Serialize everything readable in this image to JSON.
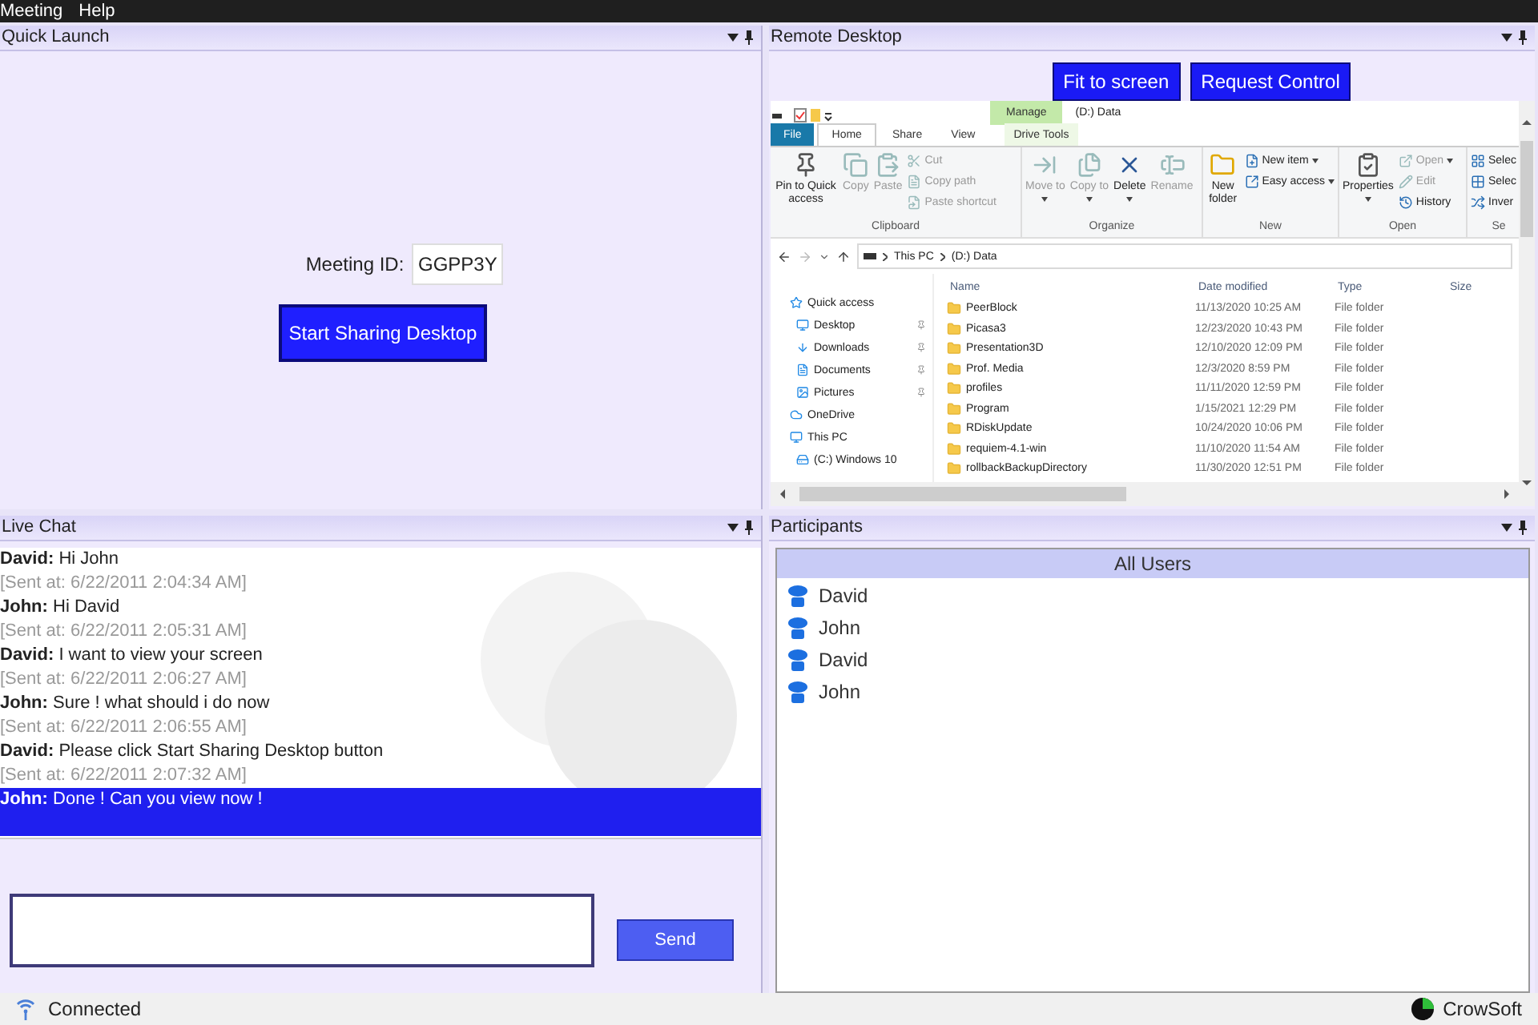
{
  "menu": [
    {
      "label": "Meeting"
    },
    {
      "label": "Help"
    }
  ],
  "quick_launch": {
    "title": "Quick Launch",
    "meeting_id_label": "Meeting ID:",
    "meeting_id": "GGPP3Y",
    "start_button": "Start Sharing Desktop"
  },
  "remote_desktop": {
    "title": "Remote Desktop",
    "buttons": [
      "Fit to screen",
      "Request Control"
    ],
    "explorer": {
      "context_tab": "Manage",
      "title": "(D:) Data",
      "tabs": [
        {
          "label": "File",
          "kind": "file",
          "selected": false
        },
        {
          "label": "Home",
          "kind": "tab",
          "selected": true
        },
        {
          "label": "Share",
          "kind": "tab",
          "selected": false
        },
        {
          "label": "View",
          "kind": "tab",
          "selected": false
        },
        {
          "label": "Drive Tools",
          "kind": "context",
          "selected": false
        }
      ],
      "groups": [
        {
          "label": "Clipboard",
          "commands": [
            {
              "label": "Pin to Quick access",
              "kind": "large",
              "disabled": false,
              "caret": false
            },
            {
              "label": "Copy",
              "kind": "large",
              "disabled": true,
              "caret": false
            },
            {
              "label": "Paste",
              "kind": "large",
              "disabled": true,
              "caret": false
            },
            {
              "label": "Cut",
              "kind": "small",
              "disabled": true,
              "caret": false
            },
            {
              "label": "Copy path",
              "kind": "small",
              "disabled": true,
              "caret": false
            },
            {
              "label": "Paste shortcut",
              "kind": "small",
              "disabled": true,
              "caret": false
            }
          ]
        },
        {
          "label": "Organize",
          "commands": [
            {
              "label": "Move to",
              "kind": "large",
              "disabled": true,
              "caret": true
            },
            {
              "label": "Copy to",
              "kind": "large",
              "disabled": true,
              "caret": true
            },
            {
              "label": "Delete",
              "kind": "large",
              "disabled": false,
              "caret": true
            },
            {
              "label": "Rename",
              "kind": "large",
              "disabled": true,
              "caret": false
            }
          ]
        },
        {
          "label": "New",
          "commands": [
            {
              "label": "New folder",
              "kind": "large",
              "disabled": false,
              "caret": false
            },
            {
              "label": "New item",
              "kind": "small",
              "disabled": false,
              "caret": true
            },
            {
              "label": "Easy access",
              "kind": "small",
              "disabled": false,
              "caret": true
            }
          ]
        },
        {
          "label": "Open",
          "commands": [
            {
              "label": "Properties",
              "kind": "large",
              "disabled": false,
              "caret": true
            },
            {
              "label": "Open",
              "kind": "small",
              "disabled": true,
              "caret": true
            },
            {
              "label": "Edit",
              "kind": "small",
              "disabled": true,
              "caret": false
            },
            {
              "label": "History",
              "kind": "small",
              "disabled": false,
              "caret": false
            }
          ]
        },
        {
          "label": "Se",
          "commands": [
            {
              "label": "Selec",
              "kind": "small",
              "disabled": false,
              "caret": false
            },
            {
              "label": "Selec",
              "kind": "small",
              "disabled": false,
              "caret": false
            },
            {
              "label": "Inver",
              "kind": "small",
              "disabled": false,
              "caret": false
            }
          ]
        }
      ],
      "path": [
        "This PC",
        "(D:) Data"
      ],
      "nav": [
        {
          "label": "Quick access",
          "kind": "star",
          "children": [
            {
              "label": "Desktop",
              "kind": "desktop",
              "pinned": true
            },
            {
              "label": "Downloads",
              "kind": "download",
              "pinned": true
            },
            {
              "label": "Documents",
              "kind": "document",
              "pinned": true
            },
            {
              "label": "Pictures",
              "kind": "picture",
              "pinned": true
            }
          ]
        },
        {
          "label": "OneDrive",
          "kind": "cloud"
        },
        {
          "label": "This PC",
          "kind": "pc",
          "children": [
            {
              "label": "(C:) Windows 10",
              "kind": "drive",
              "pinned": false
            }
          ]
        }
      ],
      "columns": [
        "Name",
        "Date modified",
        "Type",
        "Size"
      ],
      "files": [
        {
          "name": "PeerBlock",
          "modified": "11/13/2020 10:25 AM",
          "type": "File folder"
        },
        {
          "name": "Picasa3",
          "modified": "12/23/2020 10:43 PM",
          "type": "File folder"
        },
        {
          "name": "Presentation3D",
          "modified": "12/10/2020 12:09 PM",
          "type": "File folder"
        },
        {
          "name": "Prof. Media",
          "modified": "12/3/2020 8:59 PM",
          "type": "File folder"
        },
        {
          "name": "profiles",
          "modified": "11/11/2020 12:59 PM",
          "type": "File folder"
        },
        {
          "name": "Program",
          "modified": "1/15/2021 12:29 PM",
          "type": "File folder"
        },
        {
          "name": "RDiskUpdate",
          "modified": "10/24/2020 10:06 PM",
          "type": "File folder"
        },
        {
          "name": "requiem-4.1-win",
          "modified": "11/10/2020 11:54 AM",
          "type": "File folder"
        },
        {
          "name": "rollbackBackupDirectory",
          "modified": "11/30/2020 12:51 PM",
          "type": "File folder"
        }
      ]
    }
  },
  "live_chat": {
    "title": "Live Chat",
    "messages": [
      {
        "sender": "David:",
        "text": "Hi John",
        "sent": "[Sent at: 6/22/2011 2:04:34 AM]",
        "selected": false
      },
      {
        "sender": "John:",
        "text": "Hi David",
        "sent": "[Sent at: 6/22/2011 2:05:31 AM]",
        "selected": false
      },
      {
        "sender": "David:",
        "text": "I want to view your screen",
        "sent": "[Sent at: 6/22/2011 2:06:27 AM]",
        "selected": false
      },
      {
        "sender": "John:",
        "text": "Sure ! what should i do now",
        "sent": "[Sent at: 6/22/2011 2:06:55 AM]",
        "selected": false
      },
      {
        "sender": "David:",
        "text": "Please click Start Sharing Desktop button",
        "sent": "[Sent at: 6/22/2011 2:07:32 AM]",
        "selected": false
      },
      {
        "sender": "John:",
        "text": "Done ! Can you view now !",
        "selected": true
      }
    ],
    "send_button": "Send"
  },
  "participants": {
    "title": "Participants",
    "header": "All Users",
    "users": [
      {
        "name": "David"
      },
      {
        "name": "John"
      },
      {
        "name": "David"
      },
      {
        "name": "John"
      }
    ]
  },
  "status_bar": {
    "status": "Connected",
    "brand": "CrowSoft"
  }
}
